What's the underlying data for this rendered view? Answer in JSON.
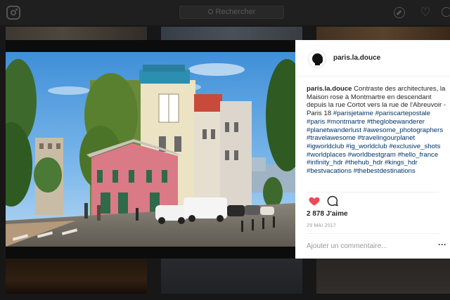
{
  "header": {
    "search_placeholder": "Rechercher",
    "icons": [
      "instagram-logo-icon",
      "search-icon",
      "compass-icon",
      "heart-icon",
      "profile-icon"
    ]
  },
  "post": {
    "username": "paris.la.douce",
    "caption_user": "paris.la.douce",
    "caption_text": " Contraste des architectures, la Maison rose à Montmartre en descendant depuis la rue Cortot vers la rue de l'Abreuvoir - Paris 18 ",
    "hashtags": "#parisjetaime #pariscartepostale #paris #montmartre #theglobewanderer #planetwanderlust #awesome_photographers #travelawesome #travelingourplanet #igworldclub #ig_worldclub #exclusive_shots #worldplaces #worldbestgram #hello_france #infinity_hdr #thehub_hdr #kings_hdr #bestvacations #thebestdestinations",
    "likes": "2 878 J'aime",
    "date": "29 MAI 2017",
    "comment_placeholder": "Ajouter un commentaire...",
    "more_label": "···"
  },
  "colors": {
    "like_red": "#ed4956",
    "hashtag_blue": "#003569",
    "text_dark": "#262626",
    "muted": "#999999"
  }
}
